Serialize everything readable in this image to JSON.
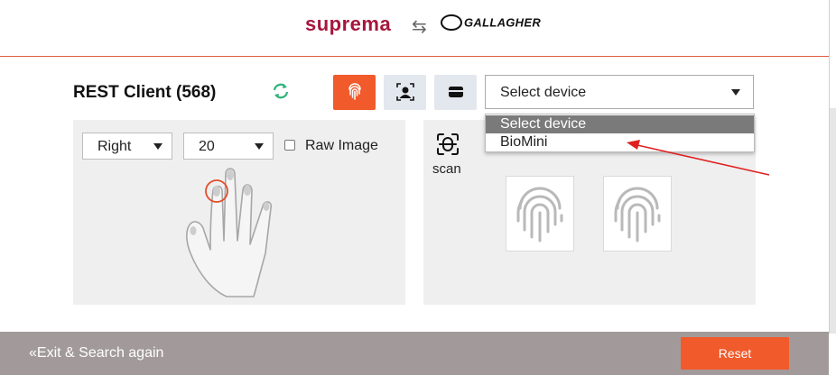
{
  "header": {
    "brand_left": "suprema",
    "swap_symbol": "⇆",
    "brand_right": "GALLAGHER"
  },
  "main": {
    "title": "REST Client (568)",
    "refresh_icon": "refresh-icon",
    "modes": [
      {
        "icon": "fingerprint-icon",
        "active": true
      },
      {
        "icon": "face-icon",
        "active": false
      },
      {
        "icon": "card-icon",
        "active": false
      }
    ],
    "device_select": {
      "value": "Select device",
      "options": [
        "Select device",
        "BioMini"
      ],
      "highlighted_option": "Select device"
    }
  },
  "left_panel": {
    "hand_select_value": "Right",
    "finger_select_value": "20",
    "raw_image_label": "Raw Image",
    "raw_image_checked": false
  },
  "right_panel": {
    "scan_label": "scan"
  },
  "footer": {
    "exit_label": "Exit & Search again",
    "exit_icon": "double-chevron-left-icon",
    "reset_label": "Reset"
  },
  "colors": {
    "accent": "#f15a2b",
    "brand": "#a6163d",
    "footer_bg": "#a29a9a",
    "panel_bg": "#efefef",
    "annotation_arrow": "#e02020"
  }
}
